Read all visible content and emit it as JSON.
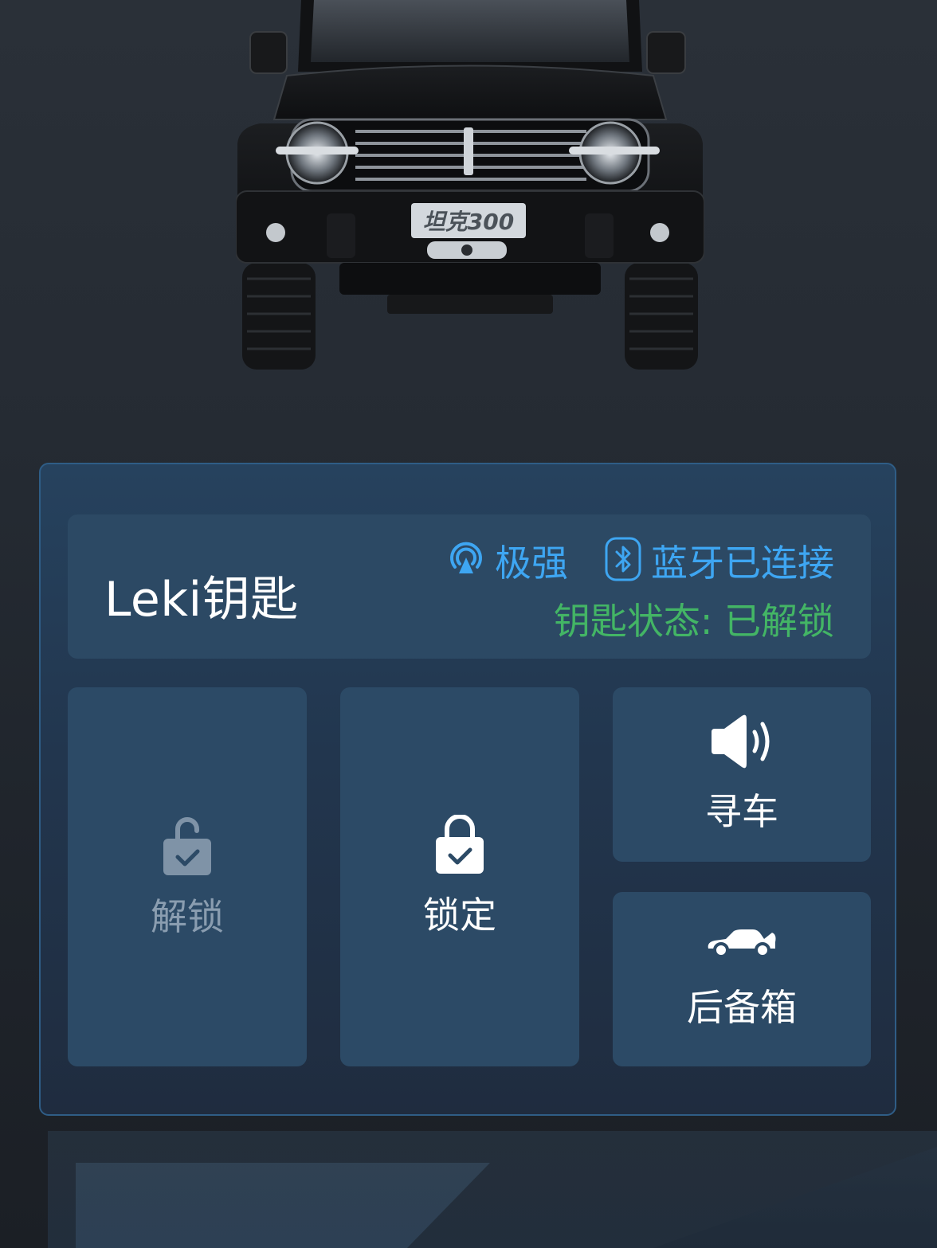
{
  "car": {
    "plate_text": "坦克300"
  },
  "key_card": {
    "title": "Leki钥匙",
    "signal_icon": "signal-broadcast-icon",
    "signal_label": "极强",
    "bluetooth_icon": "bluetooth-icon",
    "bluetooth_label": "蓝牙已连接",
    "state_label": "钥匙状态: 已解锁"
  },
  "actions": {
    "unlock": {
      "icon": "unlock-icon",
      "label": "解锁"
    },
    "lock": {
      "icon": "lock-icon",
      "label": "锁定"
    },
    "find_car": {
      "icon": "speaker-icon",
      "label": "寻车"
    },
    "trunk": {
      "icon": "car-trunk-icon",
      "label": "后备箱"
    }
  },
  "colors": {
    "accent_blue": "#3ea6f2",
    "status_green": "#43b565",
    "panel_border": "#2f5d86",
    "tile_bg": "#2c4a66",
    "disabled_text": "#8a9db0"
  }
}
